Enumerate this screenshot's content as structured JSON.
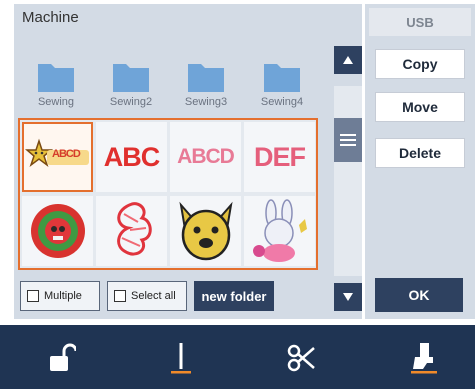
{
  "header": {
    "title": "Machine",
    "usb_tab": "USB"
  },
  "folders": [
    {
      "label": "Sewing"
    },
    {
      "label": "Sewing2"
    },
    {
      "label": "Sewing3"
    },
    {
      "label": "Sewing4"
    }
  ],
  "designs": [
    {
      "kind": "star-abcd",
      "text": "ABCD",
      "selected": true
    },
    {
      "kind": "text",
      "text": "ABC"
    },
    {
      "kind": "text",
      "text": "ABCD"
    },
    {
      "kind": "text",
      "text": "DEF"
    },
    {
      "kind": "flower-skull"
    },
    {
      "kind": "dragon"
    },
    {
      "kind": "bulldog"
    },
    {
      "kind": "bunny"
    }
  ],
  "actions": {
    "copy": "Copy",
    "move": "Move",
    "delete": "Delete",
    "ok": "OK"
  },
  "footer_controls": {
    "multiple": "Multiple",
    "select_all": "Select all",
    "new_folder": "new folder"
  },
  "icons": {
    "scroll_up": "triangle-up-icon",
    "scroll_down": "triangle-down-icon",
    "scroll_thumb": "hamburger-icon",
    "bottom": [
      "unlock-icon",
      "needle-icon",
      "thread-cutter-icon",
      "presser-foot-icon"
    ]
  },
  "colors": {
    "accent_orange": "#e46f2e",
    "navy": "#2e4160",
    "bar": "#1f3453",
    "folder_blue": "#6fa4d8"
  }
}
